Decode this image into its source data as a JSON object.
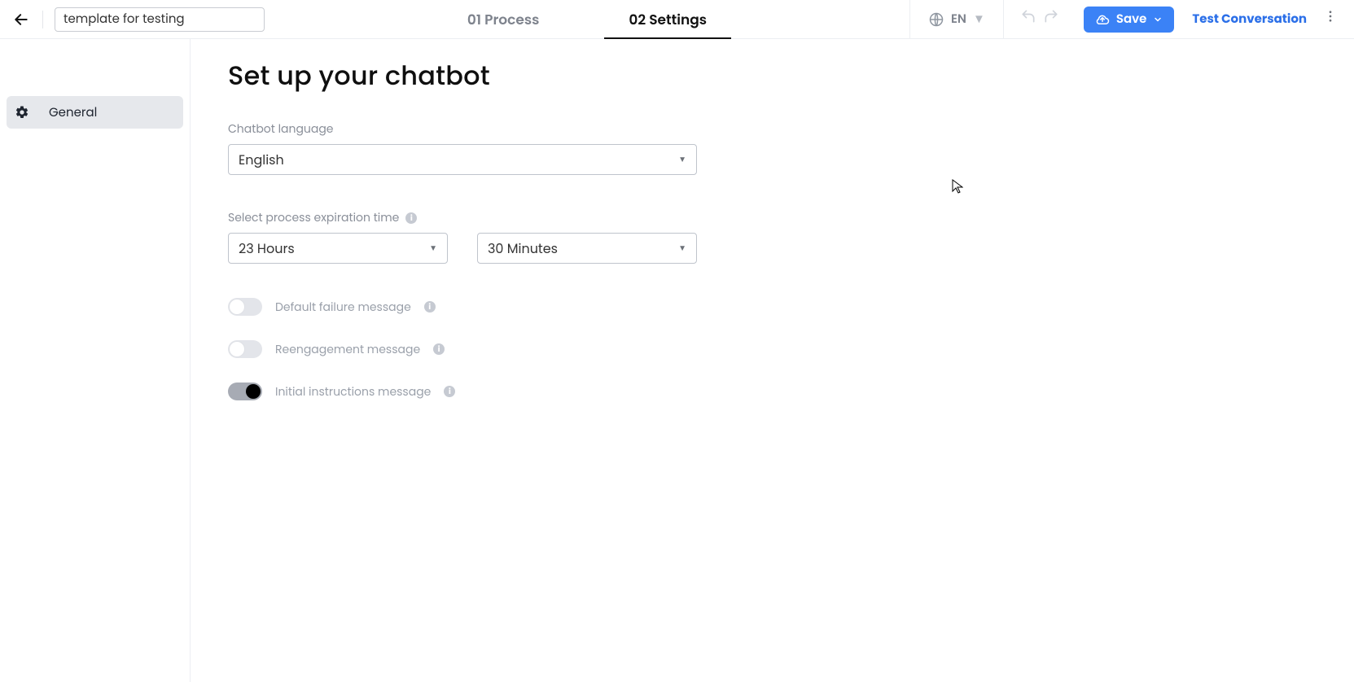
{
  "header": {
    "title_value": "template for testing",
    "tabs": {
      "process": "01 Process",
      "settings": "02 Settings"
    },
    "lang_label": "EN",
    "save_label": "Save",
    "test_label": "Test Conversation"
  },
  "sidebar": {
    "items": [
      {
        "label": "General"
      }
    ]
  },
  "main": {
    "title": "Set up your chatbot",
    "lang_field_label": "Chatbot language",
    "lang_select_value": "English",
    "expiration_label": "Select process expiration time",
    "hours_value": "23 Hours",
    "minutes_value": "30 Minutes",
    "switches": {
      "failure_label": "Default failure message",
      "reengage_label": "Reengagement message",
      "initial_label": "Initial instructions message"
    }
  }
}
